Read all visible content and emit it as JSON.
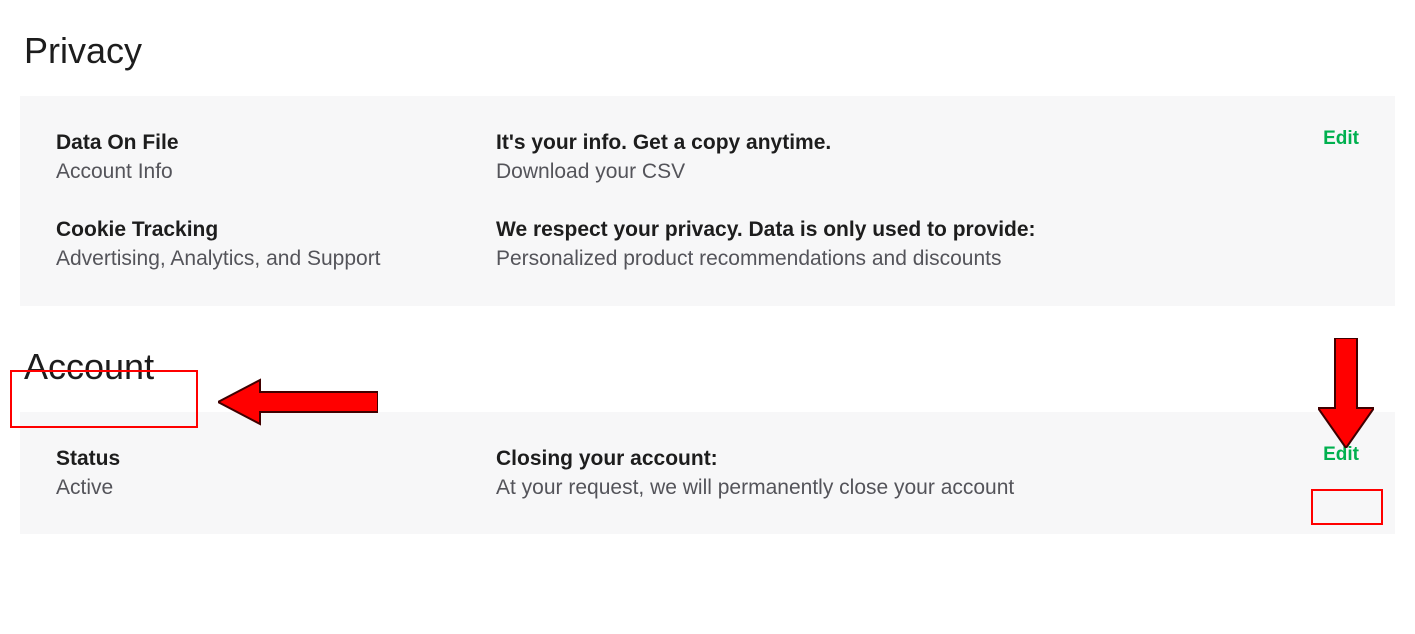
{
  "sections": {
    "privacy": {
      "title": "Privacy",
      "rows": [
        {
          "left_bold": "Data On File",
          "left_sub": "Account Info",
          "mid_bold": "It's your info. Get a copy anytime.",
          "mid_sub": "Download your CSV",
          "edit": "Edit"
        },
        {
          "left_bold": "Cookie Tracking",
          "left_sub": "Advertising, Analytics, and Support",
          "mid_bold": "We respect your privacy. Data is only used to provide:",
          "mid_sub": "Personalized product recommendations and discounts",
          "edit": ""
        }
      ]
    },
    "account": {
      "title": "Account",
      "rows": [
        {
          "left_bold": "Status",
          "left_sub": "Active",
          "mid_bold": "Closing your account:",
          "mid_sub": "At your request, we will permanently close your account",
          "edit": "Edit"
        }
      ]
    }
  }
}
